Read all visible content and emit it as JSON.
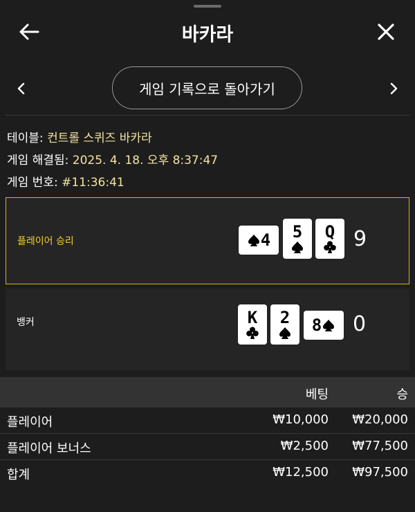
{
  "header": {
    "title": "바카라"
  },
  "nav": {
    "back_to_history": "게임 기록으로 돌아가기"
  },
  "info": {
    "table_label": "테이블:",
    "table_value": "컨트롤 스퀴즈 바카라",
    "resolved_label": "게임 해결됨:",
    "resolved_value": "2025. 4. 18. 오후 8:37:47",
    "number_label": "게임 번호:",
    "number_value": "#11:36:41"
  },
  "player": {
    "label": "플레이어 승리",
    "score": "9",
    "cards": [
      {
        "rank": "4",
        "suit": "spade",
        "sideways": true
      },
      {
        "rank": "5",
        "suit": "spade",
        "sideways": false
      },
      {
        "rank": "Q",
        "suit": "club",
        "sideways": false
      }
    ]
  },
  "banker": {
    "label": "뱅커",
    "score": "0",
    "cards": [
      {
        "rank": "K",
        "suit": "club",
        "sideways": false
      },
      {
        "rank": "2",
        "suit": "spade",
        "sideways": false
      },
      {
        "rank": "8",
        "suit": "spade",
        "sideways": true
      }
    ]
  },
  "bets": {
    "header_bet": "베팅",
    "header_win": "승",
    "rows": [
      {
        "label": "플레이어",
        "bet": "₩10,000",
        "win": "₩20,000"
      },
      {
        "label": "플레이어 보너스",
        "bet": "₩2,500",
        "win": "₩77,500"
      }
    ],
    "total": {
      "label": "합계",
      "bet": "₩12,500",
      "win": "₩97,500"
    }
  },
  "colors": {
    "background": "#1d1d1d",
    "winner_border": "#d6b417",
    "winner_text": "#f2cf2a",
    "info_value": "#f2e3a2"
  },
  "icons": {
    "back": "arrow-left-icon",
    "close": "close-icon",
    "prev": "chevron-left-icon",
    "next": "chevron-right-icon"
  }
}
